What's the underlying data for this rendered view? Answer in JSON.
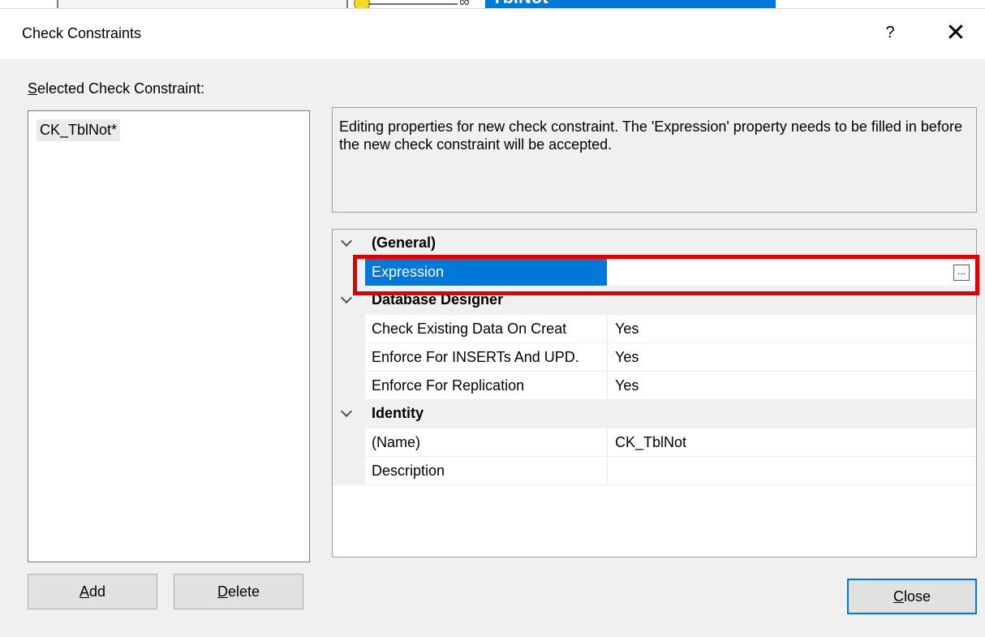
{
  "background": {
    "tab_title": "TblNot *"
  },
  "dialog": {
    "title": "Check Constraints",
    "help_symbol": "?",
    "close_symbol": "✕",
    "selected_label": "Selected Check Constraint:",
    "list_items": [
      "CK_TblNot*"
    ],
    "info_text": "Editing properties for new check constraint.  The 'Expression' property needs to be filled in before the new check constraint will be accepted.",
    "properties": {
      "general": {
        "category": "(General)",
        "expression": {
          "name": "Expression",
          "value": "",
          "button": "..."
        }
      },
      "database_designer": {
        "category": "Database Designer",
        "check_existing": {
          "name": "Check Existing Data On Creat",
          "value": "Yes"
        },
        "enforce_inserts": {
          "name": "Enforce For INSERTs And UPD.",
          "value": "Yes"
        },
        "enforce_replication": {
          "name": "Enforce For Replication",
          "value": "Yes"
        }
      },
      "identity": {
        "category": "Identity",
        "name_prop": {
          "name": "(Name)",
          "value": "CK_TblNot"
        },
        "description": {
          "name": "Description",
          "value": ""
        }
      }
    },
    "buttons": {
      "add": "Add",
      "delete": "Delete",
      "close": "Close"
    },
    "colors": {
      "selection": "#0078d7",
      "highlight": "#e00000"
    }
  }
}
